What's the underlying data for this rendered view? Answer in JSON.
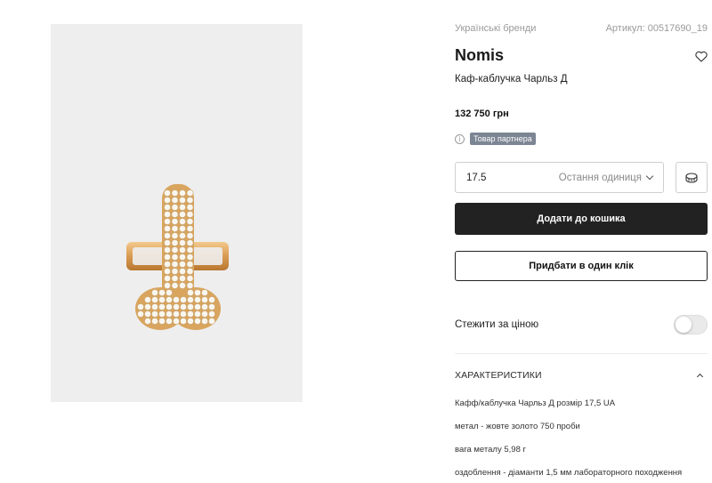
{
  "product": {
    "category_link": "Українські бренди",
    "sku": "Артикул: 00517690_19",
    "brand": "Nomis",
    "title": "Каф-каблучка Чарльз Д",
    "price": "132 750 грн",
    "partner_badge": "Товар партнера"
  },
  "size_select": {
    "value": "17.5",
    "stock_note": "Остання одиниця"
  },
  "actions": {
    "add_to_cart": "Додати до кошика",
    "buy_one_click": "Придбати в один клік"
  },
  "price_watch": {
    "label": "Стежити за ціною",
    "enabled": false
  },
  "specs": {
    "header": "ХАРАКТЕРИСТИКИ",
    "lines": [
      "Кафф/каблучка Чарльз Д розмір 17,5 UA",
      "метал - жовте золото 750 проби",
      "вага металу 5,98 г",
      "оздоблення - діаманти 1,5 мм лабораторного походження"
    ]
  },
  "icons": {
    "wishlist": "heart-icon",
    "info": "info-icon",
    "size_guide": "ring-size-icon",
    "dropdown": "chevron-down-icon",
    "collapse": "chevron-up-icon"
  },
  "colors": {
    "primary_button": "#222222",
    "badge": "#7c8593",
    "image_bg": "#eeeeee",
    "gold": "#d9a55e"
  }
}
